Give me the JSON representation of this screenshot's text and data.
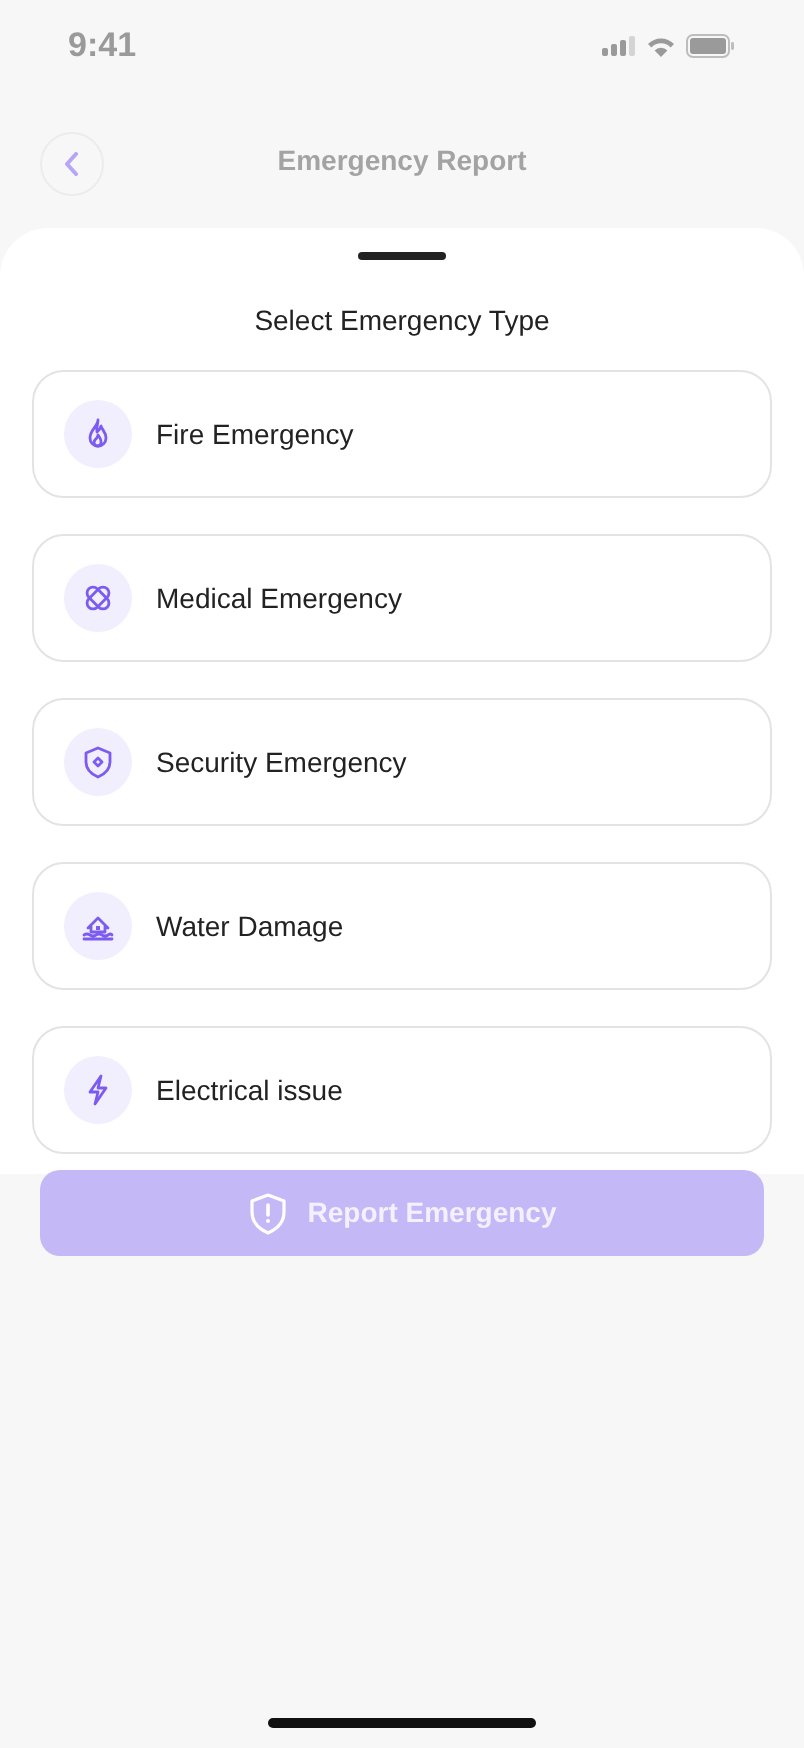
{
  "status_bar": {
    "time": "9:41"
  },
  "header": {
    "title": "Emergency Report"
  },
  "sheet": {
    "title": "Select Emergency Type",
    "options": [
      {
        "kind": "fire",
        "label": "Fire Emergency",
        "selected": false
      },
      {
        "kind": "medical",
        "label": "Medical Emergency",
        "selected": false
      },
      {
        "kind": "security",
        "label": "Security Emergency",
        "selected": false
      },
      {
        "kind": "water",
        "label": "Water Damage",
        "selected": false
      },
      {
        "kind": "electrical",
        "label": "Electrical issue",
        "selected": false
      }
    ]
  },
  "report_button": {
    "label": "Report Emergency",
    "disabled": true
  }
}
